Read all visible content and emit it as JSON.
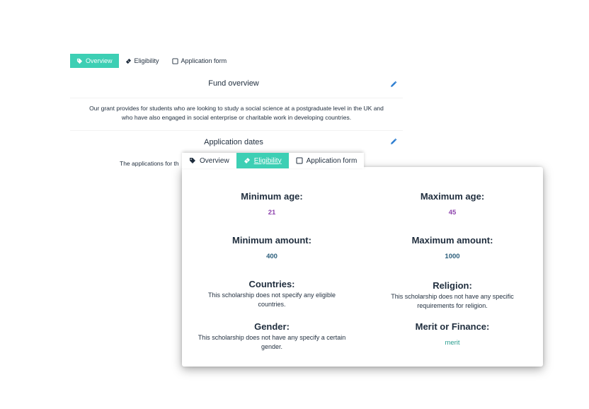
{
  "back": {
    "tabs": [
      {
        "label": "Overview",
        "icon": "tag-icon",
        "active": true
      },
      {
        "label": "Eligibility",
        "icon": "ticket-icon",
        "active": false
      },
      {
        "label": "Application form",
        "icon": "form-icon",
        "active": false
      }
    ],
    "fund_overview_title": "Fund overview",
    "fund_overview_text": "Our grant provides for students who are looking to study a social science at a postgraduate level in the UK and who have also engaged in social enterprise or charitable work in developing countries.",
    "application_dates_title": "Application dates",
    "application_dates_text": "The applications for th"
  },
  "front": {
    "tabs": [
      {
        "label": "Overview",
        "icon": "tag-icon",
        "active": false
      },
      {
        "label": "Eligibility",
        "icon": "ticket-icon",
        "active": true
      },
      {
        "label": "Application form",
        "icon": "form-icon",
        "active": false
      }
    ],
    "min_age": {
      "label": "Minimum age:",
      "value": "21"
    },
    "max_age": {
      "label": "Maximum age:",
      "value": "45"
    },
    "min_amount": {
      "label": "Minimum amount:",
      "value": "400"
    },
    "max_amount": {
      "label": "Maximum amount:",
      "value": "1000"
    },
    "countries": {
      "label": "Countries:",
      "value": "This scholarship does not specify any eligible countries."
    },
    "religion": {
      "label": "Religion:",
      "value": "This scholarship does not have any specific requirements for religion."
    },
    "gender": {
      "label": "Gender:",
      "value": "This scholarship does not have any specify a certain gender."
    },
    "merit": {
      "label": "Merit or Finance:",
      "value": "merit"
    }
  },
  "colors": {
    "accent": "#3dcfb4",
    "edit_icon": "#2f7fd1",
    "age_value": "#8e44ad",
    "amount_value": "#2c5f7c",
    "merit_value": "#2a9d8f"
  }
}
